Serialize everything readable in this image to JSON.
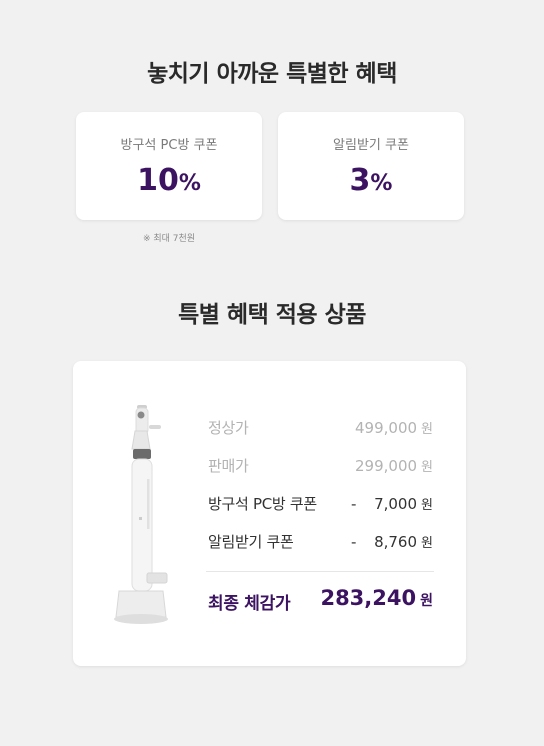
{
  "section1": {
    "title": "놓치기 아까운 특별한 혜택"
  },
  "coupons": [
    {
      "label": "방구석 PC방 쿠폰",
      "value": "10",
      "unit": "%"
    },
    {
      "label": "알림받기 쿠폰",
      "value": "3",
      "unit": "%"
    }
  ],
  "coupon_note": "※ 최대 7천원",
  "section2": {
    "title": "특별 혜택 적용 상품"
  },
  "product": {
    "image_icon": "cordless-vacuum-icon",
    "rows": [
      {
        "label": "정상가",
        "prefix": "",
        "amount": "499,000",
        "unit": "원"
      },
      {
        "label": "판매가",
        "prefix": "",
        "amount": "299,000",
        "unit": "원"
      },
      {
        "label": "방구석 PC방 쿠폰",
        "prefix": "-",
        "amount": "7,000",
        "unit": "원"
      },
      {
        "label": "알림받기 쿠폰",
        "prefix": "-",
        "amount": "8,760",
        "unit": "원"
      }
    ],
    "final": {
      "label": "최종 체감가",
      "amount": "283,240",
      "unit": "원"
    }
  },
  "colors": {
    "accent": "#3c1361",
    "background": "#f1f1f1",
    "muted": "#b3b3b3"
  }
}
